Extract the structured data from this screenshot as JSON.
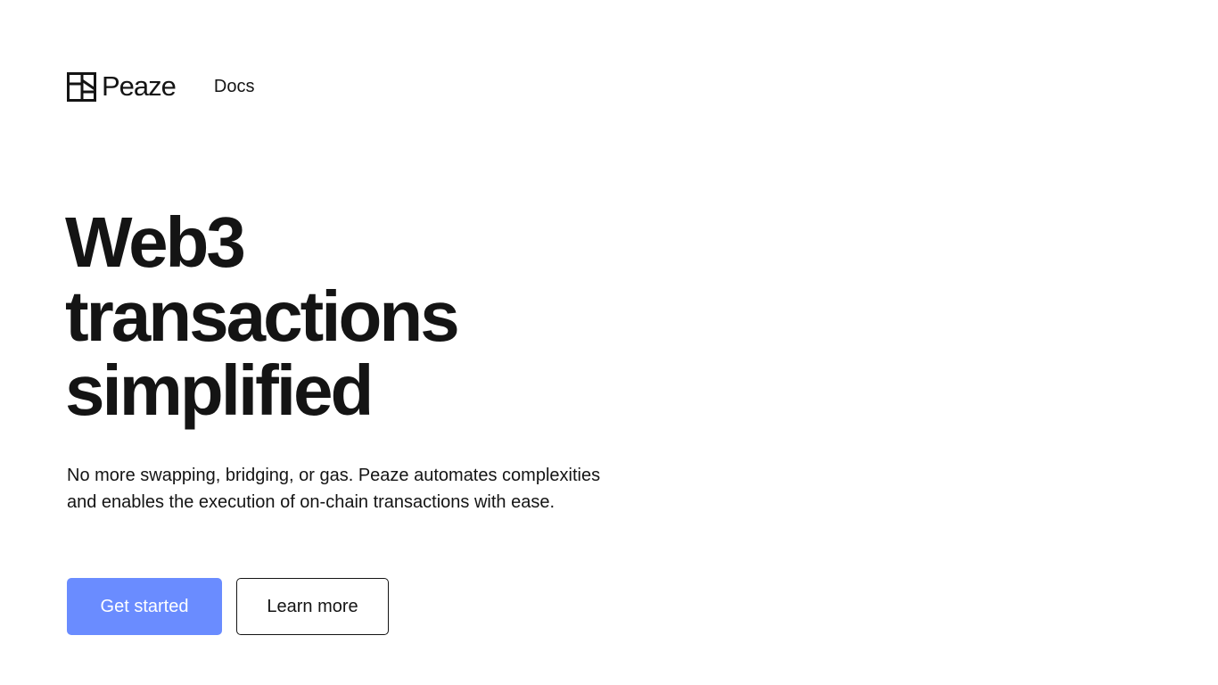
{
  "nav": {
    "brand": "Peaze",
    "links": [
      {
        "label": "Docs"
      }
    ]
  },
  "hero": {
    "title_lines": [
      "Web3",
      "transactions",
      "simplified"
    ],
    "subtitle": "No more swapping, bridging, or gas. Peaze automates complexities and enables the execution of on-chain transactions with ease.",
    "primary_button": "Get started",
    "secondary_button": "Learn more"
  },
  "colors": {
    "primary": "#6a8cff",
    "text": "#141414",
    "background": "#ffffff"
  },
  "icons": {
    "logo": "peaze-logo-icon"
  }
}
